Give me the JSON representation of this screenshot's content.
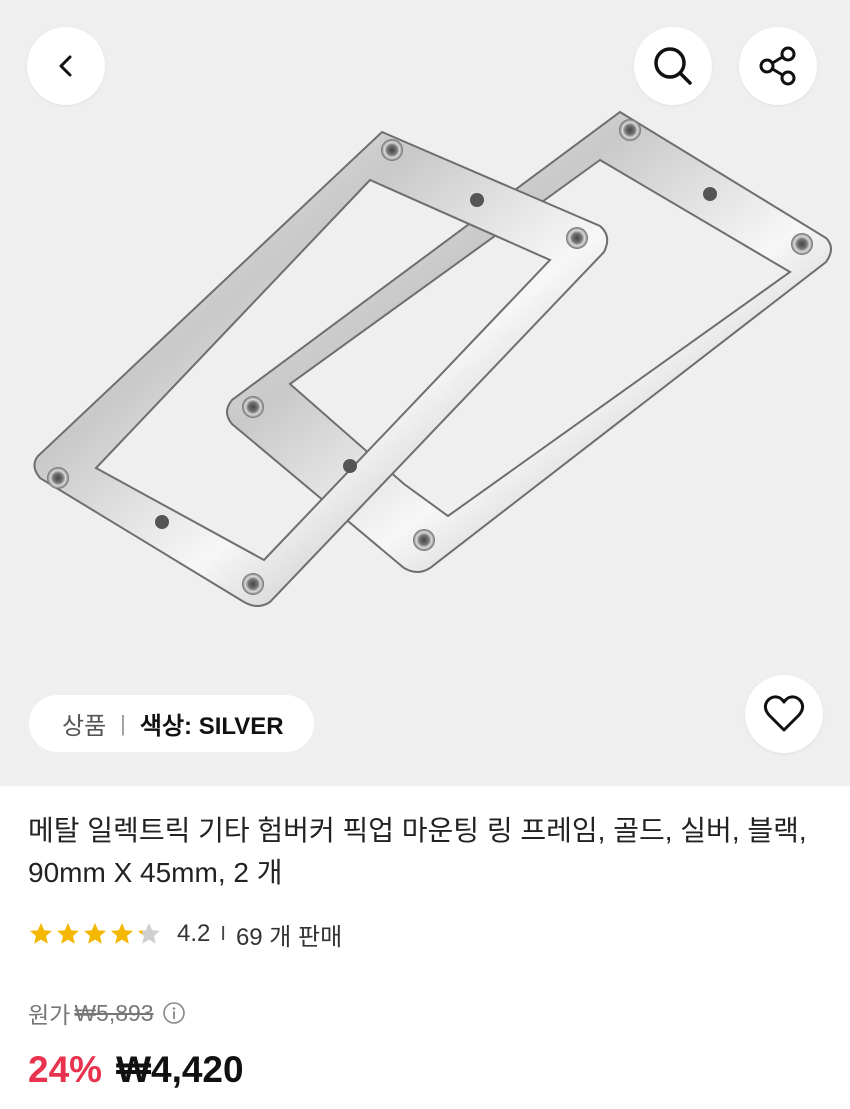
{
  "header": {
    "back_icon": "chevron-left-icon",
    "search_icon": "search-icon",
    "share_icon": "share-icon"
  },
  "gallery": {
    "option_label": "상품",
    "option_separator": "|",
    "option_value": "색상: SILVER",
    "wishlist_icon": "heart-outline-icon"
  },
  "product": {
    "title": "메탈 일렉트릭 기타 험버커 픽업 마운팅 링 프레임, 골드, 실버, 블랙, 90mm X 45mm, 2 개",
    "rating": "4.2",
    "rating_stars": 4.2,
    "rating_divider": "I",
    "sold_count": "69 개 판매",
    "original_label": "원가",
    "original_price": "₩5,893",
    "discount": "24%",
    "sale_price": "₩4,420"
  },
  "colors": {
    "hero_bg": "#efefef",
    "star": "#f5b800",
    "discount": "#e8344e"
  }
}
